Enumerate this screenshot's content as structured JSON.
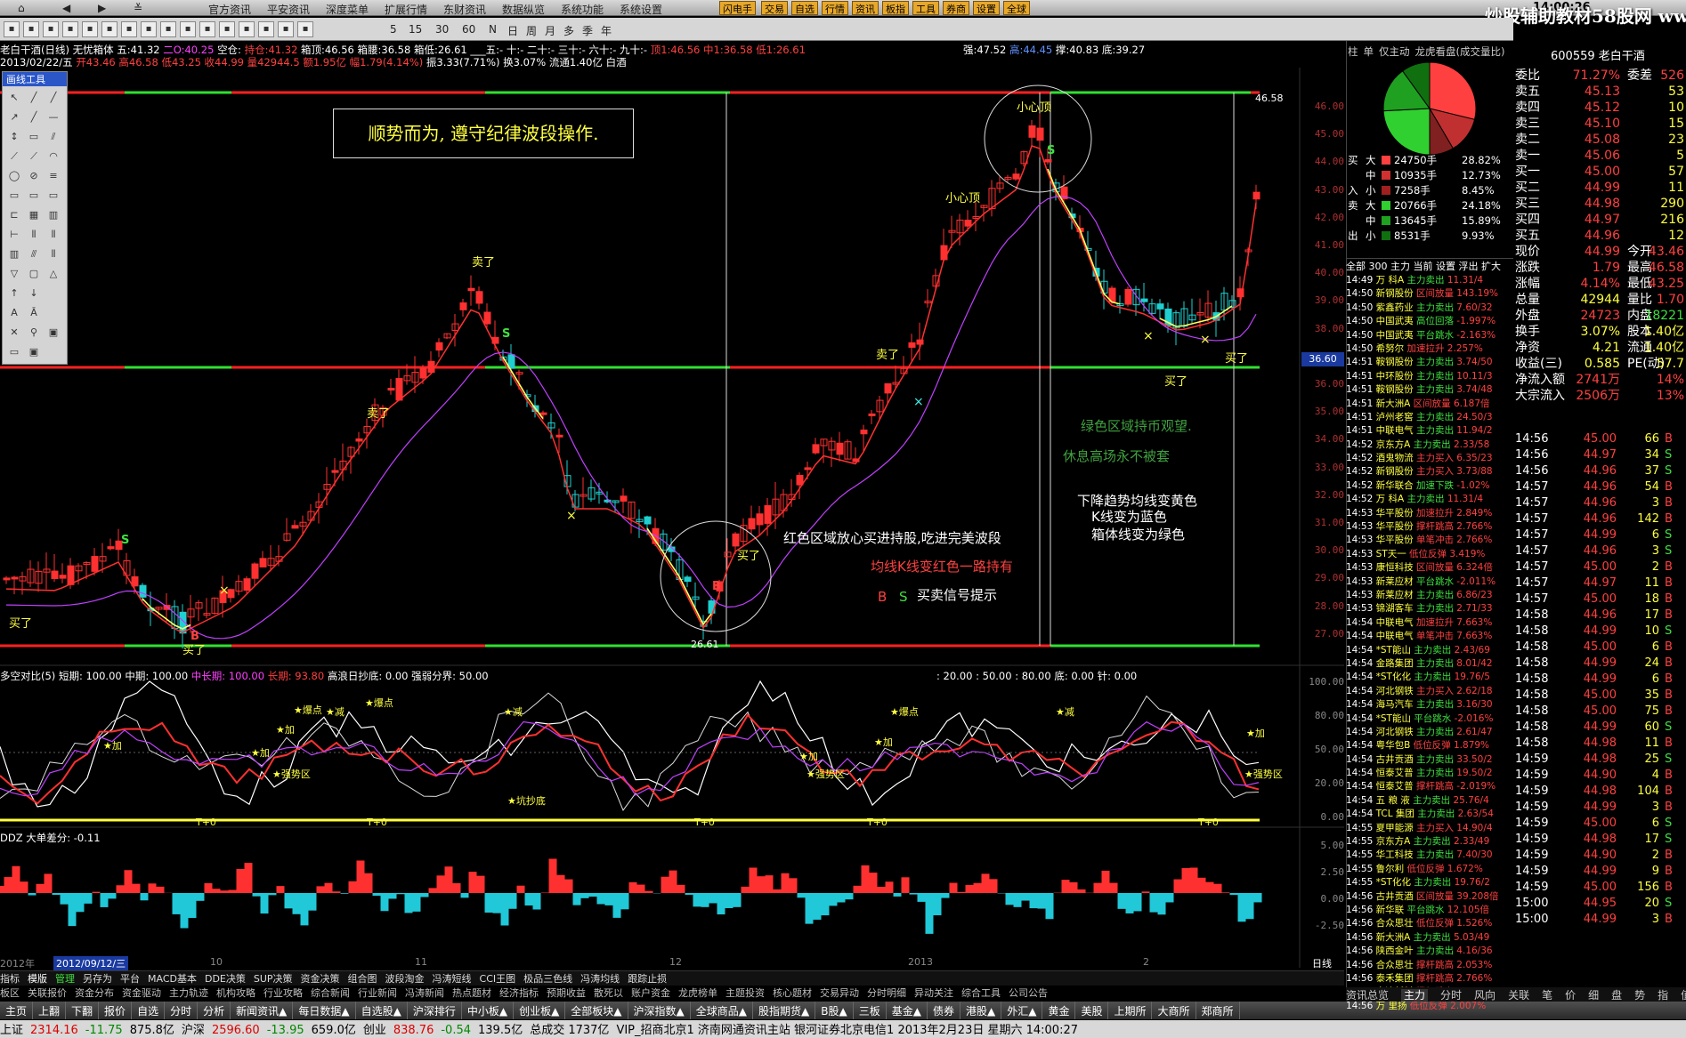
{
  "menubar": {
    "items": [
      "官方资讯",
      "平安资讯",
      "深度菜单",
      "扩展行情",
      "东财资讯",
      "数据纵览",
      "系统功能",
      "系统设置"
    ],
    "buttons": [
      "闪电手",
      "交易",
      "自选",
      "行情",
      "资讯",
      "板指",
      "工具",
      "券商",
      "设置",
      "全球"
    ],
    "clock": "14:00:26",
    "watermark": "炒股辅助教材58股网 www.58Gu.com"
  },
  "toolbar": {
    "labels": [
      "5",
      "15",
      "30",
      "60",
      "N",
      "日",
      "周",
      "月",
      "多",
      "季",
      "年"
    ]
  },
  "info": {
    "line1": [
      {
        "t": "老白干酒(日线) 无忧箱体 五:41.32 ",
        "c": "wht"
      },
      {
        "t": "二O:40.25 ",
        "c": "mag"
      },
      {
        "t": "空仓: ",
        "c": "wht"
      },
      {
        "t": "持仓:41.32 ",
        "c": "red"
      },
      {
        "t": "箱顶:46.56 箱腰:36.58 箱低:26.61 ",
        "c": "wht"
      },
      {
        "t": "___五:- 十:- 二十:- 三十:- 六十:- 九十:- ",
        "c": "wht"
      },
      {
        "t": "顶1:46.56 中1:36.58 低1:26.61",
        "c": "red"
      }
    ],
    "line1_right": [
      {
        "t": "强:47.52 ",
        "c": "wht"
      },
      {
        "t": "高:44.45 ",
        "c": "blu"
      },
      {
        "t": "撑:40.83 ",
        "c": "wht"
      },
      {
        "t": "底:39.27",
        "c": "wht"
      }
    ],
    "line2": [
      {
        "t": "2013/02/22/五 ",
        "c": "wht"
      },
      {
        "t": "开43.46 高46.58 低43.25 收44.99 量42944.5 额1.95亿 幅1.79(4.14%) ",
        "c": "red"
      },
      {
        "t": "振3.33(7.71%) 换3.07% 流通1.40亿 白酒",
        "c": "wht"
      }
    ]
  },
  "drawtools": {
    "title": "画线工具"
  },
  "chart": {
    "banner": "顺势而为, 遵守纪律波段操作.",
    "price_label": "36.60",
    "box_top_label": "46.58",
    "box_low_label": "26.61",
    "y_ticks": [
      "46.00",
      "45.00",
      "44.00",
      "43.00",
      "42.00",
      "41.00",
      "40.00",
      "39.00",
      "38.00",
      "37.00",
      "36.00",
      "35.00",
      "34.00",
      "33.00",
      "32.00",
      "31.00",
      "30.00",
      "29.00",
      "28.00",
      "27.00"
    ],
    "annotations": {
      "buy1": "买了",
      "buy2": "买了",
      "buy3": "买了",
      "buy4": "买了",
      "buy5": "买了",
      "sell1": "卖了",
      "sell2": "卖了",
      "sell3": "卖了",
      "small_top1": "小心顶",
      "small_top2": "小心顶",
      "s1": "S",
      "s2": "S",
      "s3": "S",
      "b1": "B",
      "b2": "B"
    },
    "notes": {
      "red_zone": "红色区域放心买进持股,吃进完美波段",
      "red_line": "均线K线变红色一路持有",
      "bs_b": "B",
      "bs_s": "S",
      "bs_text": "买卖信号提示",
      "green_zone": "绿色区域持币观望.",
      "rest": "休息高场永不被套",
      "down1": "下降趋势均线变黄色",
      "down2": "K线变为蓝色",
      "down3": "箱体线变为绿色"
    }
  },
  "indicator1": {
    "header": [
      {
        "t": "多空对比(5) 短期: 100.00 中期: 100.00 ",
        "c": "wht"
      },
      {
        "t": "中长期: 100.00 ",
        "c": "mag"
      },
      {
        "t": "长期: 93.80 ",
        "c": "red"
      },
      {
        "t": "高浪日抄底: 0.00 强弱分界: 50.00",
        "c": "wht"
      }
    ],
    "header_right": ": 20.00 : 50.00 : 80.00 底: 0.00 针: 0.00",
    "axis": [
      "100.00",
      "80.00",
      "50.00",
      "20.00",
      "0.00"
    ],
    "markers": {
      "bao1": "★爆点",
      "bao2": "★爆点",
      "bao3": "★爆点",
      "jian1": "★减",
      "jian2": "★减",
      "jian3": "★减",
      "jia1": "★加",
      "jia2": "★加",
      "jia3": "★加",
      "jia4": "★加",
      "jia5": "★加",
      "jia6": "★加",
      "qrq1": "★强势区",
      "qrq2": "★强势区",
      "qrq3": "★强势区",
      "t1": "T+0",
      "t2": "T+0",
      "t3": "T+0",
      "t4": "T+0",
      "t5": "T+0",
      "zb": "★坑抄底"
    }
  },
  "indicator2": {
    "header": "DDZ 大单差分: -0.11",
    "axis": [
      "5.00",
      "2.50",
      "0.00",
      "-2.50"
    ]
  },
  "xaxis": {
    "labels": [
      "2012年",
      "2012/09/12/三",
      "10",
      "11",
      "12",
      "2013",
      "2"
    ],
    "mode": "日线"
  },
  "tabs1": [
    "指标",
    "模版",
    "管理",
    "另存为",
    "平台",
    "MACD基本",
    "DDE决策",
    "SUP决策",
    "资金决策",
    "组合图",
    "波段淘金",
    "冯涛短线",
    "CCI王图",
    "极品三色线",
    "冯涛均线",
    "跟踪止损"
  ],
  "tabs2": [
    "板区",
    "关联报价",
    "资金分布",
    "资金驱动",
    "主力轨迹",
    "机构攻略",
    "行业攻略",
    "综合新闻",
    "行业新闻",
    "冯涛新闻",
    "热点题材",
    "经济指标",
    "预期收益",
    "散死以",
    "账户资金",
    "龙虎榜单",
    "主题投资",
    "核心题材",
    "交易异动",
    "分时明细",
    "异动关注",
    "综合工具",
    "公司公告"
  ],
  "bottom_menu": [
    "主页",
    "上翻",
    "下翻",
    "报价",
    "自选",
    "分时",
    "分析",
    "新闻资讯▲",
    "每日数据▲",
    "自选股▲",
    "沪深排行",
    "中小板▲",
    "创业板▲",
    "全部板块▲",
    "沪深指数▲",
    "全球商品▲",
    "股指期货▲",
    "B股▲",
    "三板",
    "基金▲",
    "债券",
    "港股▲",
    "外汇▲",
    "黄金",
    "美股",
    "上期所",
    "大商所",
    "郑商所"
  ],
  "status": {
    "items": [
      {
        "t": "上证",
        "c": "#000"
      },
      {
        "t": "2314.16",
        "c": "#d00"
      },
      {
        "t": "-11.75",
        "c": "#080"
      },
      {
        "t": "875.8亿",
        "c": "#000"
      },
      {
        "t": "沪深",
        "c": "#000"
      },
      {
        "t": "2596.60",
        "c": "#d00"
      },
      {
        "t": "-13.95",
        "c": "#080"
      },
      {
        "t": "659.0亿",
        "c": "#000"
      },
      {
        "t": "创业",
        "c": "#000"
      },
      {
        "t": "838.76",
        "c": "#d00"
      },
      {
        "t": "-0.54",
        "c": "#080"
      },
      {
        "t": "139.5亿",
        "c": "#000"
      },
      {
        "t": "总成交 1737亿",
        "c": "#000"
      },
      {
        "t": "VIP_招商北京1 济南网通资讯主站 银河证券北京电信1 2013年2月23日 星期六 14:00:27",
        "c": "#000"
      }
    ]
  },
  "right_panel": {
    "title": "600559 老白干酒",
    "tabs": [
      "柱",
      "单",
      "仅主动",
      "龙虎看盘(成交量比)"
    ],
    "flow": [
      {
        "side": "买",
        "size": "大",
        "amt": "24750手",
        "pct": "28.82%",
        "color": "#ff4040"
      },
      {
        "side": "",
        "size": "中",
        "amt": "10935手",
        "pct": "12.73%",
        "color": "#d03030"
      },
      {
        "side": "入",
        "size": "小",
        "amt": "7258手",
        "pct": "8.45%",
        "color": "#a02020"
      },
      {
        "side": "卖",
        "size": "大",
        "amt": "20766手",
        "pct": "24.18%",
        "color": "#30d030"
      },
      {
        "side": "",
        "size": "中",
        "amt": "13645手",
        "pct": "15.89%",
        "color": "#20a020"
      },
      {
        "side": "出",
        "size": "小",
        "amt": "8531手",
        "pct": "9.93%",
        "color": "#107010"
      }
    ],
    "pie": [
      {
        "pct": 28.82,
        "color": "#ff4040"
      },
      {
        "pct": 12.73,
        "color": "#c03030"
      },
      {
        "pct": 8.45,
        "color": "#802020"
      },
      {
        "pct": 24.18,
        "color": "#30d030"
      },
      {
        "pct": 15.89,
        "color": "#20a020"
      },
      {
        "pct": 9.93,
        "color": "#107010"
      }
    ],
    "flow_tabs": "全部 300 主力 当前 设置 浮出 扩大",
    "trades": [
      [
        "14:49",
        "万 科A",
        "主力卖出",
        "11.31/4"
      ],
      [
        "14:50",
        "新钢股份",
        "区间放量",
        "143.19%"
      ],
      [
        "14:50",
        "紫鑫药业",
        "主力卖出",
        "7.60/32"
      ],
      [
        "14:50",
        "中国武夷",
        "高位回落",
        "-1.997%"
      ],
      [
        "14:50",
        "中国武夷",
        "平台跳水",
        "-2.163%"
      ],
      [
        "14:50",
        "希努尔",
        "加速拉升",
        "2.257%"
      ],
      [
        "14:51",
        "鞍钢股份",
        "主力卖出",
        "3.74/50"
      ],
      [
        "14:51",
        "中环股份",
        "主力卖出",
        "10.11/3"
      ],
      [
        "14:51",
        "鞍钢股份",
        "主力卖出",
        "3.74/48"
      ],
      [
        "14:51",
        "新大洲A",
        "区间放量",
        "6.187倍"
      ],
      [
        "14:51",
        "泸州老窖",
        "主力卖出",
        "24.50/3"
      ],
      [
        "14:51",
        "中联电气",
        "主力卖出",
        "11.94/2"
      ],
      [
        "14:52",
        "京东方A",
        "主力卖出",
        "2.33/58"
      ],
      [
        "14:52",
        "酒鬼物流",
        "主力买入",
        "6.35/23"
      ],
      [
        "14:52",
        "新钢股份",
        "主力买入",
        "3.73/88"
      ],
      [
        "14:52",
        "新华联合",
        "加速下跌",
        "-1.02%"
      ],
      [
        "14:52",
        "万 科A",
        "主力卖出",
        "11.31/4"
      ],
      [
        "14:53",
        "华平股份",
        "加速拉升",
        "2.849%"
      ],
      [
        "14:53",
        "华平股份",
        "撑杆跳高",
        "2.766%"
      ],
      [
        "14:53",
        "华平股份",
        "单笔冲击",
        "2.766%"
      ],
      [
        "14:53",
        "ST天一",
        "低位反弹",
        "3.419%"
      ],
      [
        "14:53",
        "康恒科技",
        "区间放量",
        "6.324倍"
      ],
      [
        "14:53",
        "新莱应材",
        "平台跳水",
        "-2.011%"
      ],
      [
        "14:53",
        "新莱应材",
        "主力卖出",
        "6.86/23"
      ],
      [
        "14:53",
        "锦湖客车",
        "主力卖出",
        "2.71/33"
      ],
      [
        "14:54",
        "中联电气",
        "加速拉升",
        "7.663%"
      ],
      [
        "14:54",
        "中联电气",
        "单笔冲击",
        "7.663%"
      ],
      [
        "14:54",
        "*ST能山",
        "主力卖出",
        "2.43/69"
      ],
      [
        "14:54",
        "金路集团",
        "主力卖出",
        "8.01/42"
      ],
      [
        "14:54",
        "*ST化化",
        "主力卖出",
        "19.76/5"
      ],
      [
        "14:54",
        "河北钢铁",
        "主力买入",
        "2.62/18"
      ],
      [
        "14:54",
        "海马汽车",
        "主力卖出",
        "3.16/30"
      ],
      [
        "14:54",
        "*ST能山",
        "平台跳水",
        "-2.016%"
      ],
      [
        "14:54",
        "河北钢铁",
        "主力卖出",
        "2.61/47"
      ],
      [
        "14:54",
        "粤华包B",
        "低位反弹",
        "1.879%"
      ],
      [
        "14:54",
        "古井贡酒",
        "主力卖出",
        "33.50/2"
      ],
      [
        "14:54",
        "恒泰艾普",
        "主力卖出",
        "19.50/2"
      ],
      [
        "14:54",
        "恒泰艾普",
        "撑杆跳高",
        "-2.019%"
      ],
      [
        "14:54",
        "五 粮 液",
        "主力卖出",
        "25.76/4"
      ],
      [
        "14:54",
        "TCL 集团",
        "主力卖出",
        "2.63/54"
      ],
      [
        "14:55",
        "夏甲能源",
        "主力买入",
        "14.90/4"
      ],
      [
        "14:55",
        "京东方A",
        "主力卖出",
        "2.33/49"
      ],
      [
        "14:55",
        "华工科技",
        "主力卖出",
        "7.40/30"
      ],
      [
        "14:55",
        "鲁尔利",
        "低位反弹",
        "1.672%"
      ],
      [
        "14:55",
        "*ST化化",
        "主力卖出",
        "19.76/2"
      ],
      [
        "14:56",
        "古井贡酒",
        "区间放量",
        "39.208倍"
      ],
      [
        "14:56",
        "新华联",
        "平台跳水",
        "12.105倍"
      ],
      [
        "14:56",
        "合众思壮",
        "低位反弹",
        "1.526%"
      ],
      [
        "14:56",
        "新大洲A",
        "主力卖出",
        "5.03/49"
      ],
      [
        "14:56",
        "陕西金叶",
        "主力卖出",
        "4.16/36"
      ],
      [
        "14:56",
        "合众思壮",
        "撑杆跳高",
        "2.053%"
      ],
      [
        "14:56",
        "泰禾集团",
        "撑杆跳高",
        "2.766%"
      ],
      [
        "14:56",
        "宝达新材",
        "撑杆跳高",
        "2.053%"
      ],
      [
        "14:56",
        "万 里扬",
        "低位反弹",
        "2.007%"
      ]
    ],
    "quote": [
      {
        "k": "委比",
        "p": "71.27%",
        "pc": "#ff4040",
        "v": "委差",
        "vv": "526",
        "vc": "#ff4040"
      },
      {
        "k": "卖五",
        "p": "45.13",
        "pc": "#ff4040",
        "vv": "53"
      },
      {
        "k": "卖四",
        "p": "45.12",
        "pc": "#ff4040",
        "vv": "10"
      },
      {
        "k": "卖三",
        "p": "45.10",
        "pc": "#ff4040",
        "vv": "15"
      },
      {
        "k": "卖二",
        "p": "45.08",
        "pc": "#ff4040",
        "vv": "23"
      },
      {
        "k": "卖一",
        "p": "45.06",
        "pc": "#ff4040",
        "vv": "5"
      },
      {
        "k": "买一",
        "p": "45.00",
        "pc": "#ff4040",
        "vv": "57"
      },
      {
        "k": "买二",
        "p": "44.99",
        "pc": "#ff4040",
        "vv": "11"
      },
      {
        "k": "买三",
        "p": "44.98",
        "pc": "#ff4040",
        "vv": "290"
      },
      {
        "k": "买四",
        "p": "44.97",
        "pc": "#ff4040",
        "vv": "216"
      },
      {
        "k": "买五",
        "p": "44.96",
        "pc": "#ff4040",
        "vv": "12"
      },
      {
        "k": "现价",
        "p": "44.99",
        "pc": "#ff4040",
        "v": "今开",
        "vv": "43.46",
        "vc": "#ff4040"
      },
      {
        "k": "涨跌",
        "p": "1.79",
        "pc": "#ff4040",
        "v": "最高",
        "vv": "46.58",
        "vc": "#ff4040"
      },
      {
        "k": "涨幅",
        "p": "4.14%",
        "pc": "#ff4040",
        "v": "最低",
        "vv": "43.25",
        "vc": "#ff4040"
      },
      {
        "k": "总量",
        "p": "42944",
        "pc": "#ffff40",
        "v": "量比",
        "vv": "1.70",
        "vc": "#ff4040"
      },
      {
        "k": "外盘",
        "p": "24723",
        "pc": "#ff4040",
        "v": "内盘",
        "vv": "18221",
        "vc": "#40e040"
      },
      {
        "k": "换手",
        "p": "3.07%",
        "pc": "#ffff40",
        "v": "股本",
        "vv": "1.40亿",
        "vc": "#ffff40"
      },
      {
        "k": "净资",
        "p": "4.21",
        "pc": "#ffff40",
        "v": "流通",
        "vv": "1.40亿",
        "vc": "#ffff40"
      },
      {
        "k": "收益(三)",
        "p": "0.585",
        "pc": "#ffff40",
        "v": "PE(动)",
        "vv": "57.7",
        "vc": "#ffff40"
      },
      {
        "k": "净流入额",
        "p": "2741万",
        "pc": "#ff4040",
        "v": "",
        "vv": "14%",
        "vc": "#ff4040"
      },
      {
        "k": "大宗流入",
        "p": "2506万",
        "pc": "#ff4040",
        "v": "",
        "vv": "13%",
        "vc": "#ff4040"
      }
    ],
    "ticks": [
      [
        "14:56",
        "45.00",
        "66",
        "B"
      ],
      [
        "14:56",
        "44.97",
        "34",
        "S"
      ],
      [
        "14:56",
        "44.96",
        "37",
        "S"
      ],
      [
        "14:57",
        "44.96",
        "54",
        "B"
      ],
      [
        "14:57",
        "44.96",
        "3",
        "B"
      ],
      [
        "14:57",
        "44.96",
        "142",
        "B"
      ],
      [
        "14:57",
        "44.99",
        "6",
        "S"
      ],
      [
        "14:57",
        "44.96",
        "3",
        "S"
      ],
      [
        "14:57",
        "45.00",
        "2",
        "B"
      ],
      [
        "14:57",
        "44.97",
        "11",
        "B"
      ],
      [
        "14:57",
        "45.00",
        "18",
        "B"
      ],
      [
        "14:58",
        "44.96",
        "17",
        "B"
      ],
      [
        "14:58",
        "44.99",
        "10",
        "S"
      ],
      [
        "14:58",
        "45.00",
        "6",
        "B"
      ],
      [
        "14:58",
        "44.99",
        "24",
        "B"
      ],
      [
        "14:58",
        "44.99",
        "6",
        "B"
      ],
      [
        "14:58",
        "45.00",
        "35",
        "B"
      ],
      [
        "14:58",
        "45.00",
        "75",
        "B"
      ],
      [
        "14:58",
        "44.99",
        "60",
        "S"
      ],
      [
        "14:58",
        "44.98",
        "11",
        "B"
      ],
      [
        "14:59",
        "44.98",
        "25",
        "S"
      ],
      [
        "14:59",
        "44.90",
        "4",
        "B"
      ],
      [
        "14:59",
        "44.98",
        "104",
        "B"
      ],
      [
        "14:59",
        "44.99",
        "3",
        "B"
      ],
      [
        "14:59",
        "45.00",
        "6",
        "S"
      ],
      [
        "14:59",
        "44.98",
        "17",
        "S"
      ],
      [
        "14:59",
        "44.90",
        "2",
        "B"
      ],
      [
        "14:59",
        "44.99",
        "9",
        "B"
      ],
      [
        "14:59",
        "45.00",
        "156",
        "B"
      ],
      [
        "15:00",
        "44.95",
        "20",
        "S"
      ],
      [
        "15:00",
        "44.99",
        "3",
        "B"
      ]
    ],
    "bottom_tabs": [
      "资讯总览",
      "主力",
      "分时",
      "风向",
      "关联",
      "笔",
      "价",
      "细",
      "盘",
      "势",
      "指",
      "值",
      "筹"
    ]
  }
}
